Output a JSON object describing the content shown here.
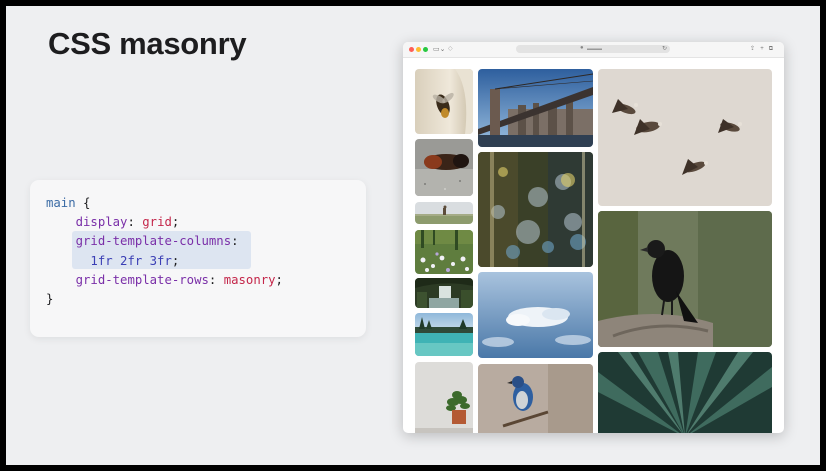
{
  "slide": {
    "title": "CSS masonry"
  },
  "code": {
    "selector": "main",
    "open_brace": " {",
    "close_brace": "}",
    "rules": [
      {
        "prop": "display",
        "value": "grid"
      },
      {
        "prop": "grid-template-columns",
        "value": ""
      },
      {
        "prop": "",
        "value": "1fr 2fr 3fr"
      },
      {
        "prop": "grid-template-rows",
        "value": "masonry"
      }
    ]
  },
  "browser": {
    "tabs_icon": "sidebar-icon",
    "address_icon": "lock-icon",
    "reload_icon": "reload-icon",
    "toolbar_icons": [
      "share-icon",
      "plus-icon",
      "tabs-icon"
    ]
  },
  "gallery": {
    "photos": [
      {
        "name": "photo-bee",
        "subject": "bee",
        "column": 1
      },
      {
        "name": "photo-caterpillar",
        "subject": "caterpillar",
        "column": 1
      },
      {
        "name": "photo-deer-field",
        "subject": "deer in field",
        "column": 1
      },
      {
        "name": "photo-wildflowers",
        "subject": "wildflowers",
        "column": 1
      },
      {
        "name": "photo-waterfall",
        "subject": "waterfall",
        "column": 1
      },
      {
        "name": "photo-lake",
        "subject": "lake",
        "column": 1
      },
      {
        "name": "photo-plant-pot",
        "subject": "potted plant",
        "column": 1
      },
      {
        "name": "photo-bridge",
        "subject": "bridge",
        "column": 2
      },
      {
        "name": "photo-bokeh",
        "subject": "bokeh lights",
        "column": 2
      },
      {
        "name": "photo-clouds",
        "subject": "clouds from above",
        "column": 2
      },
      {
        "name": "photo-jay",
        "subject": "blue jay",
        "column": 2
      },
      {
        "name": "photo-pelicans",
        "subject": "pelicans",
        "column": 3
      },
      {
        "name": "photo-crow",
        "subject": "crow",
        "column": 3
      },
      {
        "name": "photo-agave",
        "subject": "agave",
        "column": 3
      }
    ]
  }
}
